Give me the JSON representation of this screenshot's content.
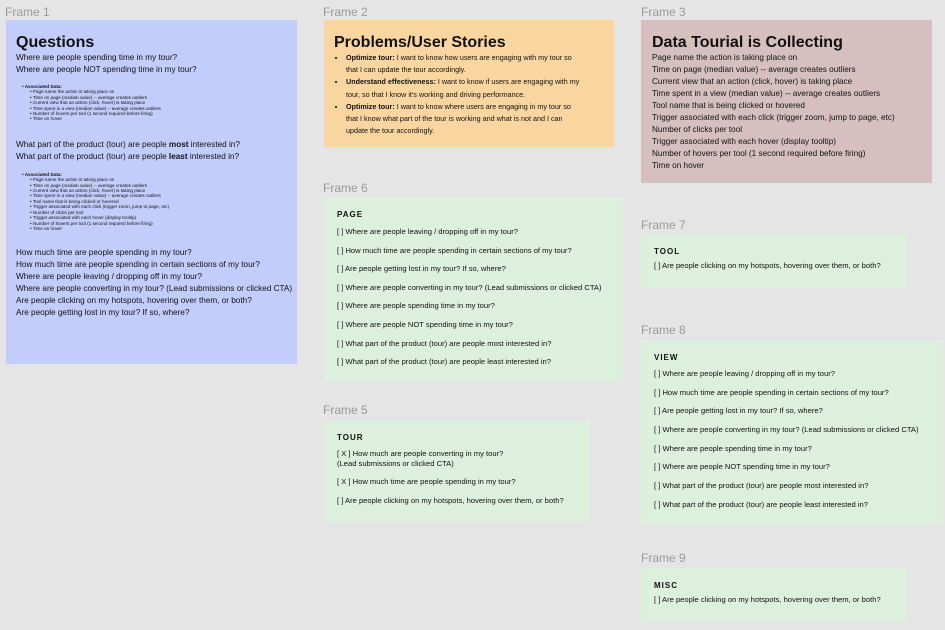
{
  "frame_labels": {
    "f1": "Frame 1",
    "f2": "Frame 2",
    "f3": "Frame 3",
    "f5": "Frame 5",
    "f6": "Frame 6",
    "f7": "Frame 7",
    "f8": "Frame 8",
    "f9": "Frame 9"
  },
  "colors": {
    "canvas": "#e5e5e5",
    "frame1": "#c3cdfb",
    "frame2": "#f9d6a0",
    "frame3": "#d6c0bf",
    "cards": "#ddefdd"
  },
  "frame1": {
    "title": "Questions",
    "q1": "Where are people spending time in my tour?",
    "q2": "Where are people NOT spending time in my tour?",
    "assoc1_heading": "Associated Data:",
    "assoc1_items": [
      "Page name the action is taking place on",
      "Time on page (median value) -- average creates outliers",
      "Current view that an action (click, hover) is taking place",
      "Time spent in a view (median value) -- average creates outliers",
      "Number of hovers per tool (1 second required before firing)",
      "Time on hover"
    ],
    "q3_pre": "What part of the product (tour) are people ",
    "q3_bold": "most",
    "q3_post": " interested in?",
    "q4_pre": "What part of the product (tour) are people ",
    "q4_bold": "least",
    "q4_post": " interested in?",
    "assoc2_heading": "Associated Data:",
    "assoc2_items": [
      "Page name the action is taking place on",
      "Time on page (median value) -- average creates outliers",
      "Current view that an action (click, hover) is taking place",
      "Time spent in a view (median value) -- average creates outliers",
      "Tool name that is being clicked or hovered",
      "Trigger associated with each click (trigger zoom, jump to page, etc)",
      "Number of clicks per tool",
      "Trigger associated with each hover (display tooltip)",
      "Number of hovers per tool (1 second required before firing)",
      "Time on hover"
    ],
    "bottom": [
      "How much time are people spending in my tour?",
      "How much time are people spending in certain sections of my tour?",
      "Where are people leaving / dropping off in my tour?",
      "Where are people converting in my tour? (Lead submissions or clicked CTA)",
      "Are people clicking on my hotspots, hovering over them, or both?",
      "Are people getting lost in my tour? If so, where?"
    ]
  },
  "frame2": {
    "title": "Problems/User Stories",
    "stories": [
      {
        "label": "Optimize tour:",
        "line1": "I want to know how users are engaging with my tour so",
        "line2": "that I can update the tour accordingly."
      },
      {
        "label": "Understand effectiveness:",
        "line1": "I want to know if users are engaging with my",
        "line2": "tour, so that I know it's working and driving performance."
      },
      {
        "label": "Optimize tour:",
        "line1": "I want to know where users are engaging in my tour so",
        "line2": "that I know what part of the tour is working and what is not and I can",
        "line3": "update the tour accordingly."
      }
    ]
  },
  "frame3": {
    "title": "Data Tourial is Collecting",
    "items": [
      "Page name the action is taking place on",
      "Time on page (median value) -- average creates outliers",
      "Current view that an action (click, hover) is taking place",
      "Time spent in a view (median value) -- average creates outliers",
      "Tool name that is being clicked or hovered",
      "Trigger associated with each click (trigger zoom, jump to page, etc)",
      "Number of clicks per tool",
      "Trigger associated with each hover (display tooltip)",
      "Number of hovers per tool (1 second required before firing)",
      "Time on hover"
    ]
  },
  "frame6": {
    "heading": "PAGE",
    "items": [
      "[ ] Where are people leaving / dropping off in my tour?",
      "[ ] How much time are people spending in certain sections of my tour?",
      "[ ] Are people getting lost in my tour? If so, where?",
      "[ ] Where are people converting in my tour? (Lead submissions or clicked CTA)",
      "[ ] Where are people spending time in my tour?",
      "[ ] Where are people NOT spending time in my tour?",
      "[ ] What part of the product (tour) are people most interested in?",
      "[ ] What part of the product (tour) are people least interested in?"
    ]
  },
  "frame5": {
    "heading": "TOUR",
    "item1_line1": "[ X ] How much are people converting in my tour?",
    "item1_line2": "(Lead submissions or clicked CTA)",
    "item2": "[ X ] How much time are people spending in my tour?",
    "item3": "[ ] Are people clicking on my hotspots, hovering over them, or both?"
  },
  "frame7": {
    "heading": "TOOL",
    "item1": "[ ] Are people clicking on my hotspots, hovering over them, or both?"
  },
  "frame8": {
    "heading": "VIEW",
    "items": [
      "[ ] Where are people leaving / dropping off in my tour?",
      "[ ] How much time are people spending in certain sections of my tour?",
      "[ ] Are people getting lost in my tour? If so, where?",
      "[ ] Where are people converting in my tour? (Lead submissions or clicked CTA)",
      "[ ] Where are people spending time in my tour?",
      "[ ] Where are people NOT spending time in my tour?",
      "[ ] What part of the product (tour) are people most interested in?",
      "[ ] What part of the product (tour) are people least interested in?"
    ]
  },
  "frame9": {
    "heading": "MISC",
    "item1": "[ ] Are people clicking on my hotspots, hovering over them, or both?"
  }
}
